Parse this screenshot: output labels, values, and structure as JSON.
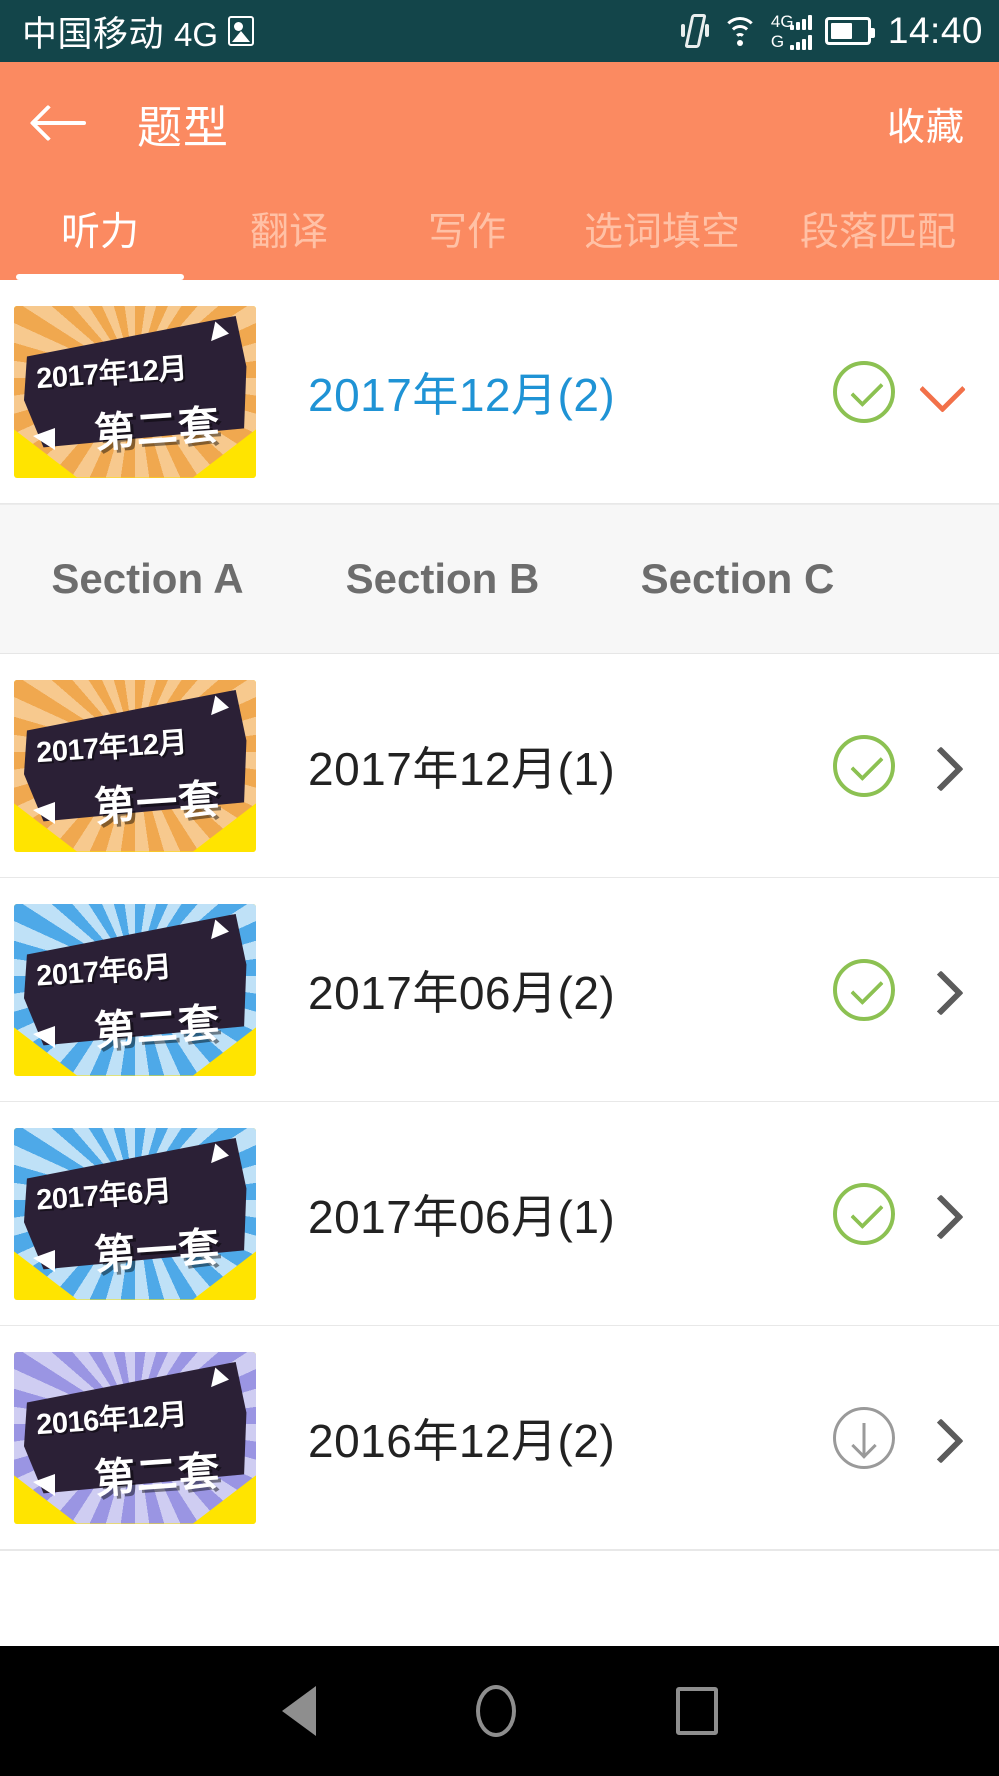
{
  "statusbar": {
    "carrier": "中国移动",
    "network": "4G",
    "sim_icon": "sim-card-icon",
    "vibrate_icon": "vibrate-icon",
    "wifi_icon": "wifi-icon",
    "signal_label_top": "4G",
    "signal_label_bottom": "G",
    "battery_icon": "battery-icon",
    "time": "14:40",
    "background": "#13454a"
  },
  "header": {
    "back_icon": "back-arrow-icon",
    "title": "题型",
    "action_label": "收藏",
    "accent": "#fb8a61"
  },
  "tabs": [
    {
      "label": "听力",
      "active": true
    },
    {
      "label": "翻译",
      "active": false
    },
    {
      "label": "写作",
      "active": false
    },
    {
      "label": "选词填空",
      "active": false
    },
    {
      "label": "段落匹配",
      "active": false
    }
  ],
  "expanded_row": {
    "thumb_line1": "2017年12月",
    "thumb_line2": "第二套",
    "thumb_theme": "orange",
    "title": "2017年12月(2)",
    "title_color": "#1f93d5",
    "status_icon": "check-circle-icon",
    "expand_icon": "chevron-down-icon",
    "expand_icon_color": "#f2714a"
  },
  "sections": [
    {
      "label": "Section A"
    },
    {
      "label": "Section B"
    },
    {
      "label": "Section C"
    }
  ],
  "rows": [
    {
      "thumb_line1": "2017年12月",
      "thumb_line2": "第一套",
      "thumb_theme": "orange",
      "title": "2017年12月(1)",
      "status_icon": "check-circle-icon",
      "chevron_icon": "chevron-right-icon"
    },
    {
      "thumb_line1": "2017年6月",
      "thumb_line2": "第二套",
      "thumb_theme": "blue",
      "title": "2017年06月(2)",
      "status_icon": "check-circle-icon",
      "chevron_icon": "chevron-right-icon"
    },
    {
      "thumb_line1": "2017年6月",
      "thumb_line2": "第一套",
      "thumb_theme": "blue",
      "title": "2017年06月(1)",
      "status_icon": "check-circle-icon",
      "chevron_icon": "chevron-right-icon"
    },
    {
      "thumb_line1": "2016年12月",
      "thumb_line2": "第二套",
      "thumb_theme": "purple",
      "title": "2016年12月(2)",
      "status_icon": "download-circle-icon",
      "chevron_icon": "chevron-right-icon"
    }
  ],
  "navbar": {
    "back_icon": "nav-back-icon",
    "home_icon": "nav-home-icon",
    "recents_icon": "nav-recents-icon"
  }
}
